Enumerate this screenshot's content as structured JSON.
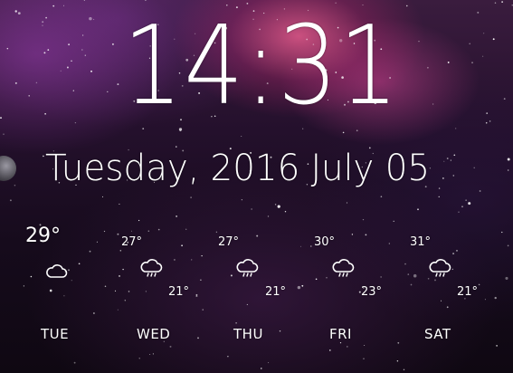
{
  "clock": {
    "time": "14:31"
  },
  "date": {
    "full": "Tuesday, 2016 July 05"
  },
  "today": {
    "temp": "29°",
    "icon": "cloud-icon"
  },
  "forecast": [
    {
      "day": "TUE"
    },
    {
      "day": "WED",
      "high": "27°",
      "low": "21°",
      "icon": "rain-cloud-icon"
    },
    {
      "day": "THU",
      "high": "27°",
      "low": "21°",
      "icon": "rain-cloud-icon"
    },
    {
      "day": "FRI",
      "high": "30°",
      "low": "23°",
      "icon": "rain-cloud-icon"
    },
    {
      "day": "SAT",
      "high": "31°",
      "low": "21°",
      "icon": "rain-cloud-icon"
    }
  ],
  "colors": {
    "text": "#ffffff",
    "nebula": "#e0558c",
    "background": "#160b1c"
  }
}
